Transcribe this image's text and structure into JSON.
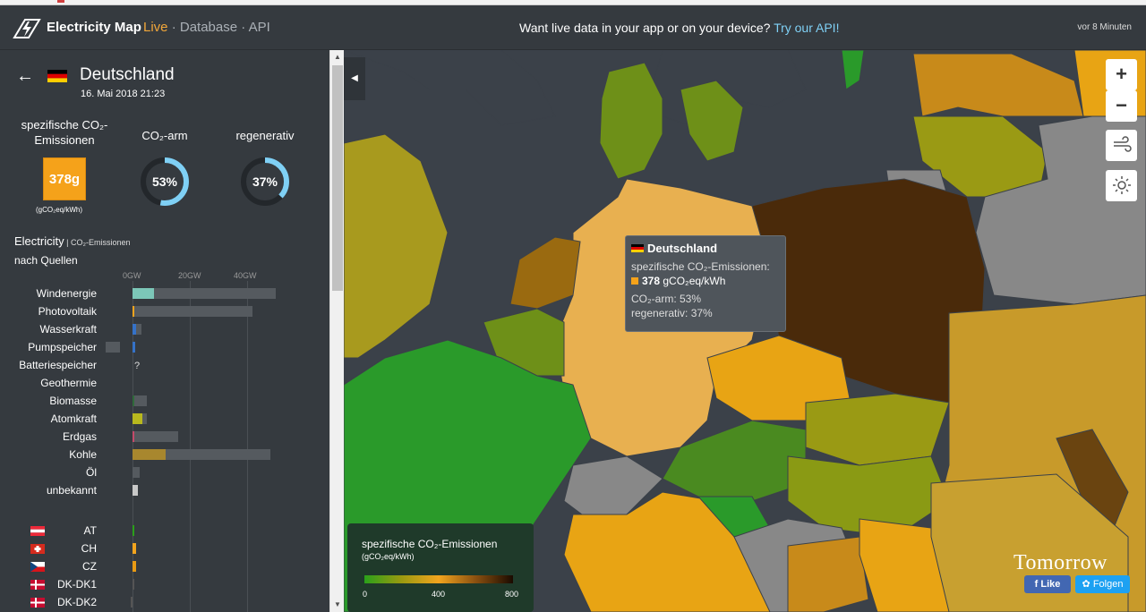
{
  "header": {
    "brand": "Electricity Map",
    "nav_live": "Live",
    "nav_rest": " · Database · API",
    "promo_text": "Want live data in your app or on your device? ",
    "promo_link": "Try our API!",
    "updated_ago": "vor 8 Minuten"
  },
  "panel": {
    "country": "Deutschland",
    "date": "16. Mai 2018 21:23",
    "co2_label_line1": "spezifische CO₂-",
    "co2_label_line2": "Emissionen",
    "co2_value": "378g",
    "co2_unit": "(gCO₂eq/kWh)",
    "lowcarbon_label": "CO₂-arm",
    "lowcarbon_value": "53%",
    "lowcarbon_pct": 53,
    "renewable_label": "regenerativ",
    "renewable_value": "37%",
    "renewable_pct": 37,
    "section_title": "Electricity",
    "section_title_small": " | CO₂-Emissionen",
    "section_sub": "nach Quellen",
    "axis_ticks": [
      "0GW",
      "20GW",
      "40GW"
    ],
    "unknown_marker": "?",
    "sources": [
      {
        "label": "Windenergie",
        "value_gw": 7.5,
        "capacity_gw": 50,
        "color": "#7cc7b8"
      },
      {
        "label": "Photovoltaik",
        "value_gw": 0.3,
        "capacity_gw": 42,
        "color": "#f2a41e"
      },
      {
        "label": "Wasserkraft",
        "value_gw": 1.3,
        "capacity_gw": 3,
        "color": "#3572c8"
      },
      {
        "label": "Pumpspeicher",
        "value_gw": 1.0,
        "capacity_gw": 5,
        "color": "#3572c8"
      },
      {
        "label": "Batteriespeicher",
        "value_gw": 0,
        "capacity_gw": 0,
        "color": "#555"
      },
      {
        "label": "Geothermie",
        "value_gw": 0,
        "capacity_gw": 0,
        "color": "#555"
      },
      {
        "label": "Biomasse",
        "value_gw": 0.2,
        "capacity_gw": 5,
        "color": "#2f6a3a"
      },
      {
        "label": "Atomkraft",
        "value_gw": 3.5,
        "capacity_gw": 5,
        "color": "#b8b81e"
      },
      {
        "label": "Erdgas",
        "value_gw": 0.7,
        "capacity_gw": 16,
        "color": "#c44a6a"
      },
      {
        "label": "Kohle",
        "value_gw": 11.5,
        "capacity_gw": 48,
        "color": "#a8872e"
      },
      {
        "label": "Öl",
        "value_gw": 0,
        "capacity_gw": 2.5,
        "color": "#555"
      },
      {
        "label": "unbekannt",
        "value_gw": 2.0,
        "capacity_gw": 0,
        "color": "#c8c8c8"
      }
    ],
    "exchanges": [
      {
        "label": "AT",
        "value_gw": 0.4,
        "color": "#2aa01a"
      },
      {
        "label": "CH",
        "value_gw": 1.3,
        "color": "#f2a41e"
      },
      {
        "label": "CZ",
        "value_gw": 1.1,
        "color": "#e89a14"
      },
      {
        "label": "DK-DK1",
        "value_gw": 0,
        "color": "#555"
      },
      {
        "label": "DK-DK2",
        "value_gw": 0.3,
        "color": "#555"
      }
    ]
  },
  "tooltip": {
    "country": "Deutschland",
    "label": "spezifische CO₂-Emissionen:",
    "value": "378",
    "unit": " gCO₂eq/kWh",
    "lowcarbon": "CO₂-arm: 53%",
    "renewable": "regenerativ: 37%"
  },
  "map_controls": {
    "zoom_in": "+",
    "zoom_out": "−"
  },
  "legend": {
    "title": "spezifische CO₂-Emissionen",
    "unit": "(gCO₂eq/kWh)",
    "ticks": [
      "0",
      "400",
      "800"
    ]
  },
  "footer": {
    "tomorrow": "Tomorrow",
    "fb": "Like",
    "tw": "Folgen"
  }
}
